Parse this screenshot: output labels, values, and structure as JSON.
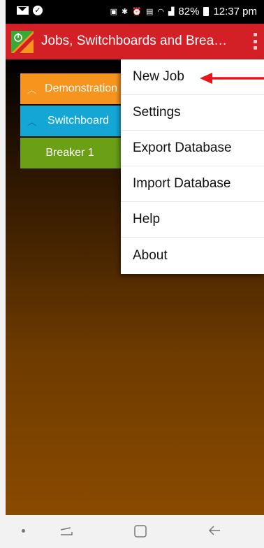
{
  "status_bar": {
    "battery": "82%",
    "time": "12:37 pm",
    "icons": [
      "mail-icon",
      "check-icon",
      "nfc-icon",
      "bluetooth-icon",
      "alarm-icon",
      "volte-icon",
      "wifi-icon",
      "signal-icon",
      "battery-icon"
    ]
  },
  "app_bar": {
    "title": "Jobs, Switchboards and Brea…",
    "icon": "app-power-icon",
    "overflow_icon": "overflow-menu-icon"
  },
  "tree": {
    "job": "Demonstration",
    "switchboard": "Switchboard",
    "breaker": "Breaker 1"
  },
  "menu": {
    "items": [
      "New Job",
      "Settings",
      "Export Database",
      "Import Database",
      "Help",
      "About"
    ]
  },
  "colors": {
    "app_bar": "#d32027",
    "job_row": "#f7941d",
    "switchboard_row": "#14a7d6",
    "breaker_row": "#6a9f16",
    "annotation_arrow": "#e8141c"
  }
}
